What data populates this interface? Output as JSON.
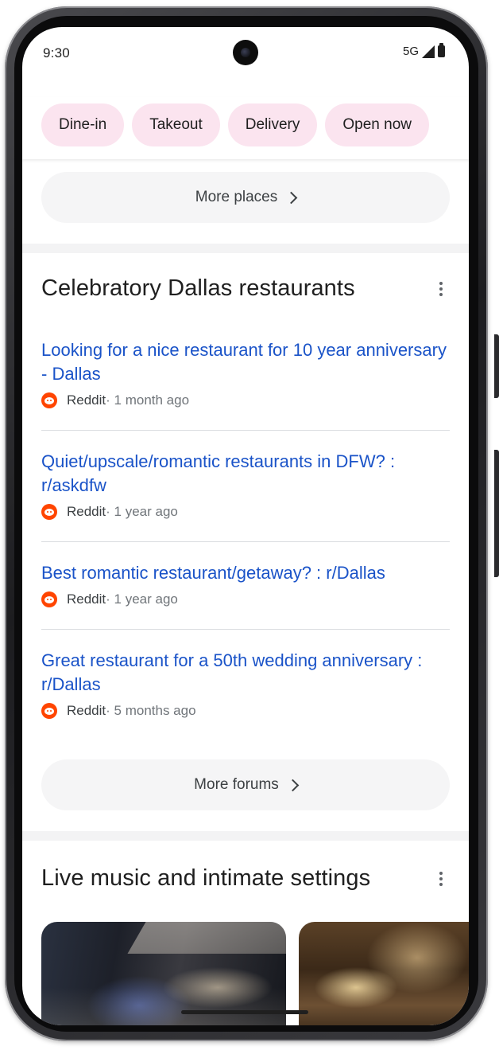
{
  "status_bar": {
    "time": "9:30",
    "network": "5G"
  },
  "filter_chips": [
    {
      "label": "Dine-in"
    },
    {
      "label": "Takeout"
    },
    {
      "label": "Delivery"
    },
    {
      "label": "Open now"
    }
  ],
  "places": {
    "more_label": "More places"
  },
  "forums_section": {
    "title": "Celebratory Dallas restaurants",
    "items": [
      {
        "title": "Looking for a nice restaurant for 10 year anniversary - Dallas",
        "source": "Reddit",
        "time": " · 1 month ago"
      },
      {
        "title": "Quiet/upscale/romantic restaurants in DFW? : r/askdfw",
        "source": "Reddit",
        "time": " · 1 year ago"
      },
      {
        "title": "Best romantic restaurant/getaway? : r/Dallas",
        "source": "Reddit",
        "time": " · 1 year ago"
      },
      {
        "title": "Great restaurant for a 50th wedding anniversary : r/Dallas",
        "source": "Reddit",
        "time": " · 5 months ago"
      }
    ],
    "more_label": "More forums"
  },
  "music_section": {
    "title": "Live music and intimate settings"
  },
  "colors": {
    "link_blue": "#1a53c8",
    "chip_pink": "#fbe4ef",
    "reddit_orange": "#ff4500"
  }
}
